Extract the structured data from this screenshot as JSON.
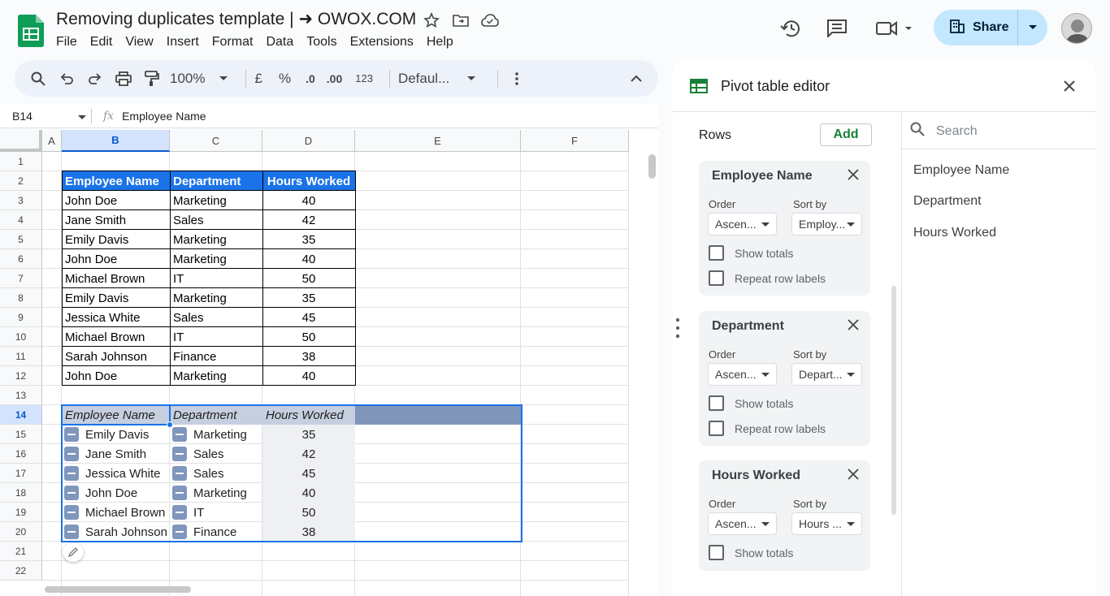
{
  "doc": {
    "title": "Removing duplicates template | ➜ OWOX.COM",
    "menu": [
      "File",
      "Edit",
      "View",
      "Insert",
      "Format",
      "Data",
      "Tools",
      "Extensions",
      "Help"
    ],
    "share_label": "Share"
  },
  "toolbar": {
    "zoom": "100%",
    "currency": "£",
    "percent": "%",
    "dec_less": ".0",
    "dec_more": ".00",
    "number_format": "123",
    "font": "Defaul..."
  },
  "formula_bar": {
    "cell_ref": "B14",
    "fx": "fx",
    "content": "Employee Name"
  },
  "grid": {
    "columns": [
      "A",
      "B",
      "C",
      "D",
      "E",
      "F"
    ],
    "rows": [
      "1",
      "2",
      "3",
      "4",
      "5",
      "6",
      "7",
      "8",
      "9",
      "10",
      "11",
      "12",
      "13",
      "14",
      "15",
      "16",
      "17",
      "18",
      "19",
      "20",
      "21",
      "22"
    ],
    "selected_column": "B",
    "selected_row": "14"
  },
  "source_table": {
    "headers": [
      "Employee Name",
      "Department",
      "Hours Worked"
    ],
    "rows": [
      [
        "John Doe",
        "Marketing",
        "40"
      ],
      [
        "Jane Smith",
        "Sales",
        "42"
      ],
      [
        "Emily Davis",
        "Marketing",
        "35"
      ],
      [
        "John Doe",
        "Marketing",
        "40"
      ],
      [
        "Michael Brown",
        "IT",
        "50"
      ],
      [
        "Emily Davis",
        "Marketing",
        "35"
      ],
      [
        "Jessica White",
        "Sales",
        "45"
      ],
      [
        "Michael Brown",
        "IT",
        "50"
      ],
      [
        "Sarah Johnson",
        "Finance",
        "38"
      ],
      [
        "John Doe",
        "Marketing",
        "40"
      ]
    ]
  },
  "pivot_table": {
    "headers": [
      "Employee Name",
      "Department",
      "Hours Worked"
    ],
    "rows": [
      [
        "Emily Davis",
        "Marketing",
        "35"
      ],
      [
        "Jane Smith",
        "Sales",
        "42"
      ],
      [
        "Jessica White",
        "Sales",
        "45"
      ],
      [
        "John Doe",
        "Marketing",
        "40"
      ],
      [
        "Michael Brown",
        "IT",
        "50"
      ],
      [
        "Sarah Johnson",
        "Finance",
        "38"
      ]
    ]
  },
  "editor": {
    "title": "Pivot table editor",
    "rows_label": "Rows",
    "add_label": "Add",
    "order_label": "Order",
    "sort_by_label": "Sort by",
    "show_totals_label": "Show totals",
    "repeat_labels_label": "Repeat row labels",
    "cards": [
      {
        "title": "Employee Name",
        "order": "Ascen...",
        "sort_by": "Employ..."
      },
      {
        "title": "Department",
        "order": "Ascen...",
        "sort_by": "Depart..."
      },
      {
        "title": "Hours Worked",
        "order": "Ascen...",
        "sort_by": "Hours ..."
      }
    ],
    "search_placeholder": "Search",
    "fields": [
      "Employee Name",
      "Department",
      "Hours Worked"
    ]
  },
  "colors": {
    "header_blue": "#1a73e8",
    "pivot_header": "#8095ba",
    "share_bg": "#c2e7ff",
    "sheets_green": "#0f9d58",
    "add_green": "#188038"
  }
}
